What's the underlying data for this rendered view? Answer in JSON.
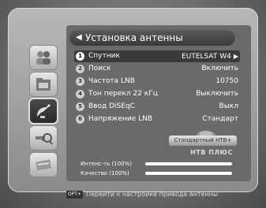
{
  "title": "Установка антенны",
  "rows": [
    {
      "num": "1",
      "label": "Спутник",
      "value": "EUTELSAT W4"
    },
    {
      "num": "2",
      "label": "Поиск",
      "value": "Включить"
    },
    {
      "num": "3",
      "label": "Частота LNB",
      "value": "10750"
    },
    {
      "num": "4",
      "label": "Тон перекл 22 кГц",
      "value": "Выключить"
    },
    {
      "num": "5",
      "label": "Ввод DiSEqC",
      "value": "Выкл"
    },
    {
      "num": "6",
      "label": "Напряжение LNB",
      "value": "Стандарт"
    }
  ],
  "sidebar": [
    {
      "icon": "people-icon",
      "selected": false
    },
    {
      "icon": "folder-icon",
      "selected": false
    },
    {
      "icon": "satellite-dish-icon",
      "selected": true
    },
    {
      "icon": "key-search-icon",
      "selected": false
    },
    {
      "icon": "tools-icon",
      "selected": false
    }
  ],
  "sat_button": "Стандартный НТВ+",
  "provider": "НТВ ПЛЮС",
  "meters": [
    {
      "label": "Интенс-ть (100%)",
      "value": 1.0
    },
    {
      "label": "Качество (100%)",
      "value": 1.0
    }
  ],
  "footer": {
    "key": "OPT+",
    "text": "Перейти к настройке привода антенны"
  }
}
